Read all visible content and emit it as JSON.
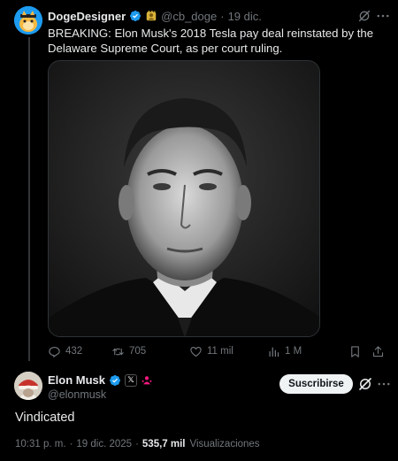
{
  "parent_tweet": {
    "display_name": "DogeDesigner",
    "handle": "@cb_doge",
    "separator": "·",
    "date": "19 dic.",
    "text": "BREAKING: Elon Musk's 2018 Tesla pay deal reinstated by the Delaware Supreme Court, as per court ruling.",
    "media_alt": "Black and white portrait photo",
    "stats": {
      "replies": "432",
      "reposts": "705",
      "likes": "11 mil",
      "views": "1 M"
    }
  },
  "main_tweet": {
    "display_name": "Elon Musk",
    "handle": "@elonmusk",
    "badge_x": "𝕏",
    "subscribe_label": "Suscribirse",
    "text": "Vindicated",
    "time": "10:31 p. m.",
    "separator": "·",
    "date": "19 dic. 2025",
    "separator2": "·",
    "views_count": "535,7 mil",
    "views_label": "Visualizaciones"
  },
  "colors": {
    "background": "#000000",
    "primary_text": "#e7e9ea",
    "secondary_text": "#71767b",
    "verified_blue": "#1d9bf0",
    "affiliate_pink": "#f91880"
  },
  "icons": [
    "verified-badge-icon",
    "subscriber-icon",
    "grok-icon",
    "more-icon",
    "reply-icon",
    "repost-icon",
    "like-icon",
    "views-icon",
    "bookmark-icon",
    "share-icon",
    "x-badge-icon",
    "affiliate-icon"
  ]
}
